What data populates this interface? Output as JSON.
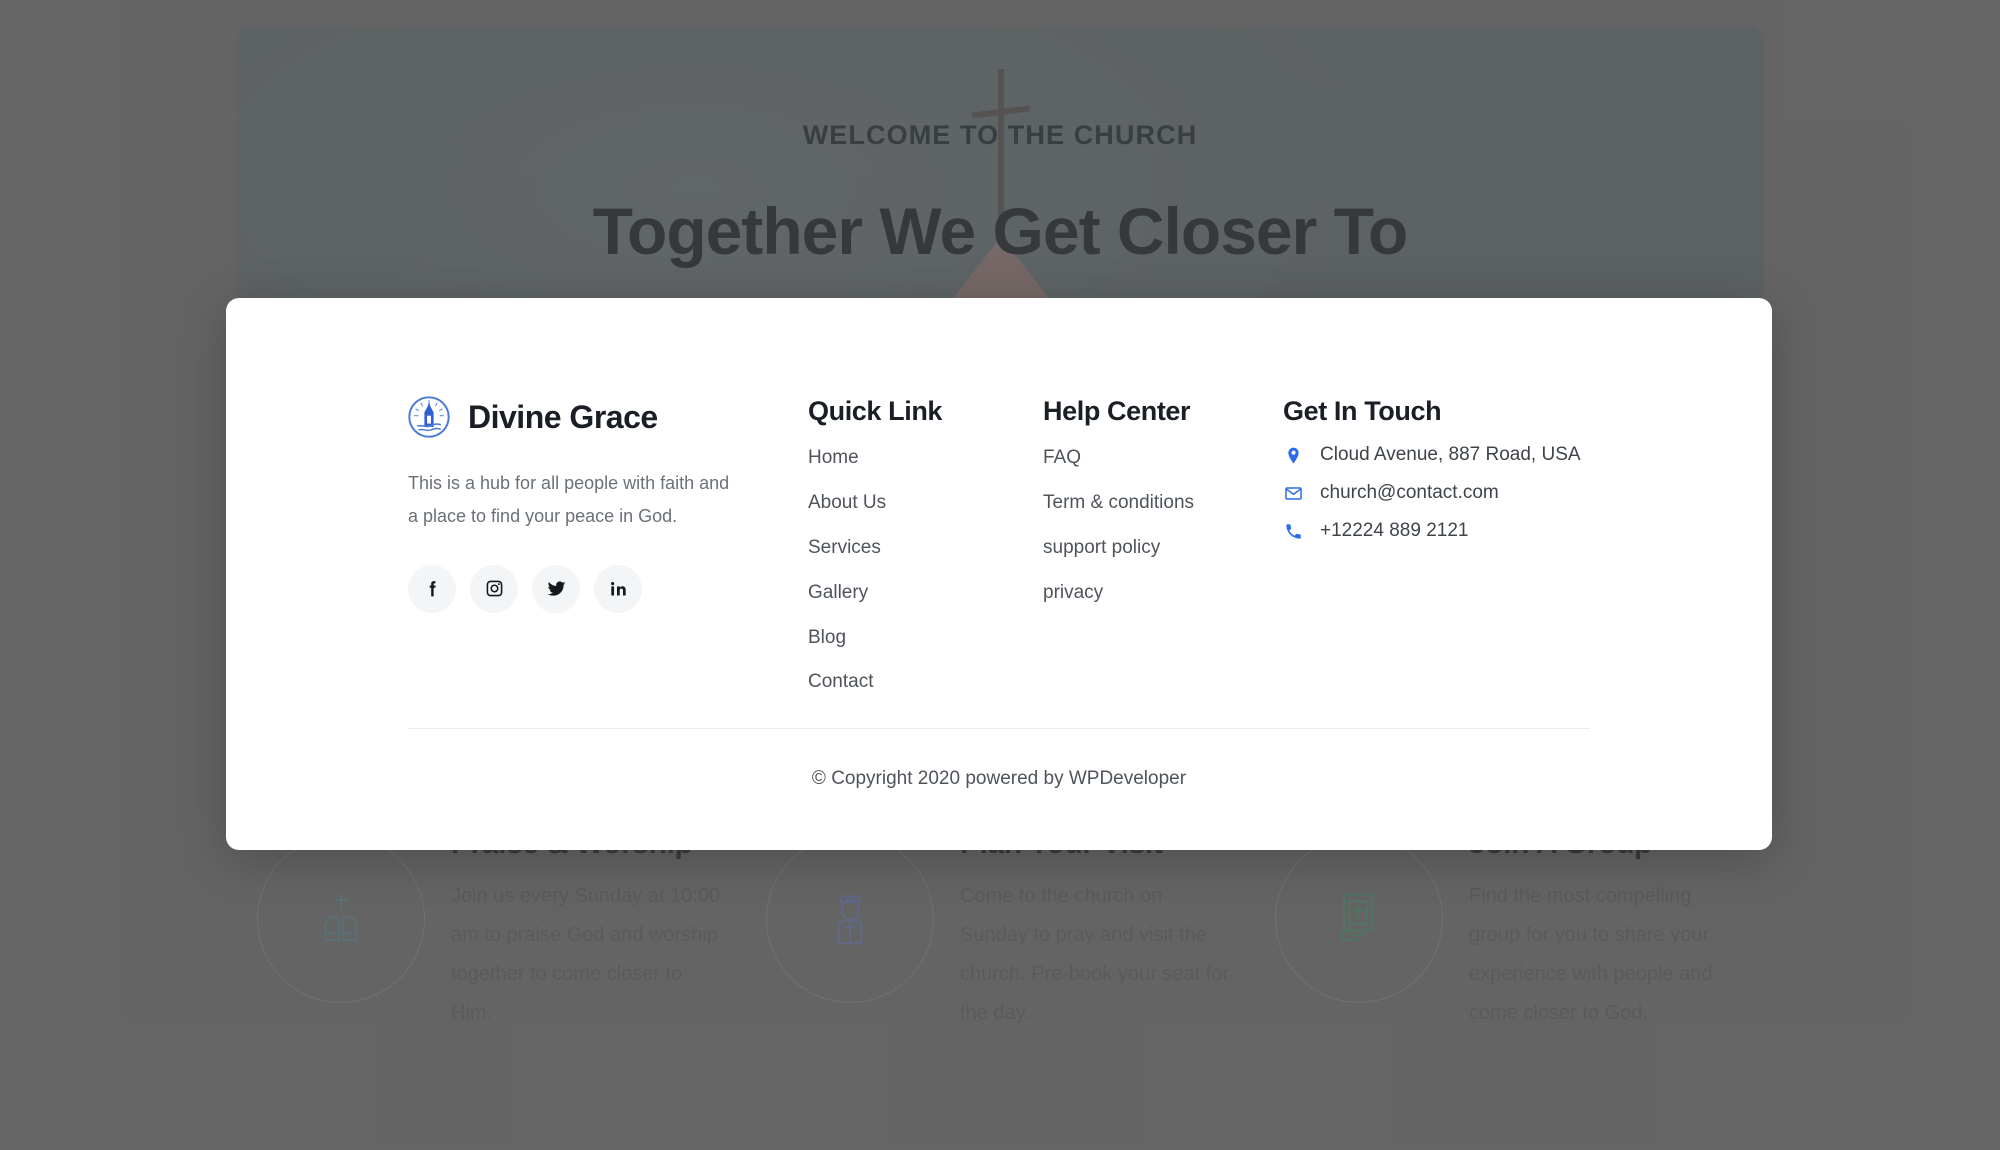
{
  "hero": {
    "eyebrow": "WELCOME TO THE CHURCH",
    "headline": "Together We Get Closer To",
    "cross_icon": "cross-icon",
    "roof_icon": "church-roof-shape"
  },
  "cards": [
    {
      "icon": "praying-hands-icon",
      "icon_color": "#5d8a95",
      "title": "Praise & Worship",
      "text": "Join us every Sunday at 10:00 am to praise God and worship together to come closer to Him."
    },
    {
      "icon": "priest-icon",
      "icon_color": "#6b7bb5",
      "title": "Plan Your Visit",
      "text": "Come to the church on Sunday to pray and visit the church. Pre-book your seat for the day."
    },
    {
      "icon": "bible-in-hand-icon",
      "icon_color": "#4e9070",
      "title": "Join A Group",
      "text": "Find the most compelling group for you to share your experience with people and come closer to God."
    }
  ],
  "footer": {
    "brand": {
      "logo_icon": "church-steeple-logo-icon",
      "name": "Divine Grace",
      "description": "This is a hub for all people with faith and a place to find your peace in God.",
      "socials": [
        {
          "icon": "facebook-icon",
          "label": "Facebook"
        },
        {
          "icon": "instagram-icon",
          "label": "Instagram"
        },
        {
          "icon": "twitter-icon",
          "label": "Twitter"
        },
        {
          "icon": "linkedin-icon",
          "label": "LinkedIn"
        }
      ]
    },
    "quick_link": {
      "heading": "Quick Link",
      "items": [
        "Home",
        "About Us",
        "Services",
        "Gallery",
        "Blog",
        "Contact"
      ]
    },
    "help_center": {
      "heading": "Help Center",
      "items": [
        "FAQ",
        "Term & conditions",
        "support policy",
        "privacy"
      ]
    },
    "get_in_touch": {
      "heading": "Get In Touch",
      "items": [
        {
          "icon": "location-pin-icon",
          "value": "Cloud Avenue, 887 Road, USA"
        },
        {
          "icon": "envelope-icon",
          "value": "church@contact.com"
        },
        {
          "icon": "phone-icon",
          "value": "+12224 889 2121"
        }
      ]
    },
    "copyright": "© Copyright 2020 powered by WPDeveloper"
  },
  "colors": {
    "accent_blue": "#2b6ce8",
    "brand_logo_blue": "#2f5fd0",
    "heading": "#1a1f25",
    "body_text": "#4f545b",
    "muted_text": "#6b7178",
    "panel_bg": "#ffffff",
    "divider": "#e9ebee",
    "social_bg": "#f4f5f7",
    "overlay": "rgba(86,86,86,0.46)"
  }
}
